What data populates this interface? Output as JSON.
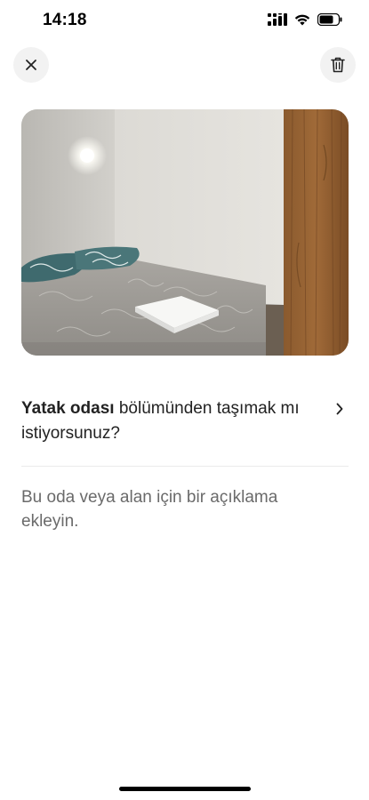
{
  "status_bar": {
    "time": "14:18"
  },
  "top_bar": {
    "close_icon": "close-icon",
    "delete_icon": "trash-icon"
  },
  "photo": {
    "subject": "bedroom-photo"
  },
  "move_prompt": {
    "room_name": "Yatak odası",
    "rest": " bölümünden taşımak mı istiyorsunuz?",
    "chevron_icon": "chevron-right-icon"
  },
  "description": {
    "placeholder": "Bu oda veya alan için bir açıklama ekleyin."
  },
  "colors": {
    "text_primary": "#222222",
    "text_secondary": "#6a6a6a",
    "button_bg": "#f2f2f2",
    "divider": "#ebebeb"
  }
}
